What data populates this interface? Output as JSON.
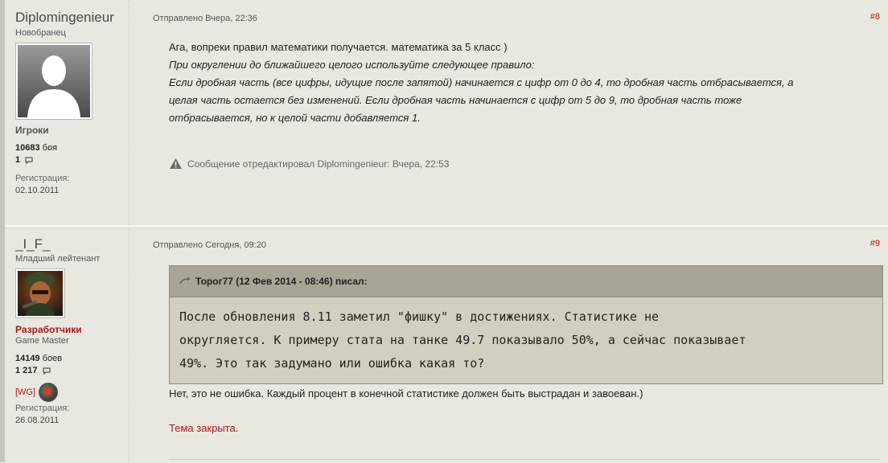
{
  "posts": [
    {
      "author": {
        "name": "Diplomingenieur",
        "rank": "Новобранец",
        "group": "Игроки",
        "battles_count": "10683",
        "battles_label": "боя",
        "messages_count": "1",
        "reg_label": "Регистрация:",
        "reg_date": "02.10.2011"
      },
      "date": "Отправлено Вчера, 22:36",
      "number": "#8",
      "content": {
        "line1": "Ага, вопреки правил математики получается. математика за 5 класс )",
        "line2": "При округлении до ближайшего целого используйте следующее правило:",
        "line3": "Если дробная часть (все цифры, идущие после запятой) начинается с цифр от 0 до 4, то дробная часть отбрасывается, а",
        "line4": "целая часть остается без изменений. Если дробная часть начинается с цифр от 5 до 9, то дробная часть тоже",
        "line5": "отбрасывается, но к целой части добавляется 1."
      },
      "edited": "Сообщение отредактировал Diplomingenieur: Вчера, 22:53"
    },
    {
      "author": {
        "name": "_I_F_",
        "rank": "Младший лейтенант",
        "group": "Разработчики",
        "subgroup": "Game Master",
        "battles_count": "14149",
        "battles_label": "боев",
        "messages_count": "1 217",
        "clan": "[WG]",
        "reg_label": "Регистрация:",
        "reg_date": "26.08.2011"
      },
      "date": "Отправлено Сегодня, 09:20",
      "number": "#9",
      "quote": {
        "header": "Торог77 (12 Фев 2014 - 08:46) писал:",
        "line1": "После обновления 8.11 заметил \"фишку\" в достижениях. Статистике не",
        "line2": "округляется. К примеру стата на танке 49.7 показывало 50%, а сейчас показывает",
        "line3": "49%. Это так задумано или ошибка какая то?"
      },
      "answer": "Нет, это не ошибка. Каждый процент в конечной статистике должен быть выстрадан и завоеван.)",
      "closed": "Тема закрыта."
    }
  ],
  "colors": {
    "background": "#e8e8e1",
    "link_red": "#b21516",
    "quote_bg": "#d2cfc0",
    "quote_head": "#a8a596"
  }
}
